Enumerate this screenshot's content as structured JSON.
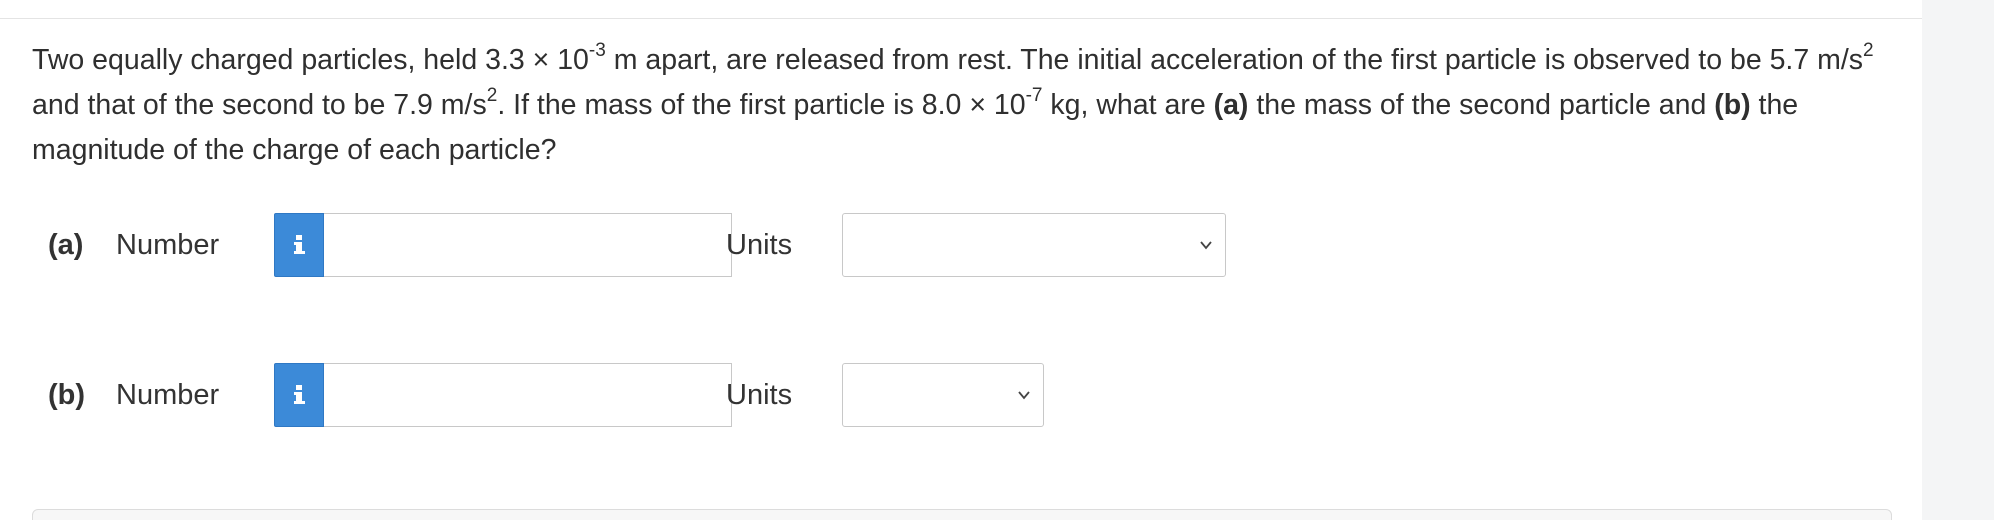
{
  "question": {
    "t1": "Two equally charged particles, held 3.3 × 10",
    "sup1": "-3",
    "t2": " m apart, are released from rest. The initial acceleration of the first particle is observed to be 5.7 m/s",
    "sup2": "2",
    "t3": " and that of the second to be 7.9 m/s",
    "sup3": "2",
    "t4": ". If the mass of the first particle is 8.0 × 10",
    "sup4": "-7",
    "t5": " kg, what are ",
    "bold_a": "(a)",
    "t6": " the mass of the second particle and ",
    "bold_b": "(b)",
    "t7": " the magnitude of the charge of each particle?"
  },
  "parts": [
    {
      "label": "(a)",
      "number_label": "Number",
      "number_value": "",
      "units_label": "Units",
      "units_selected": ""
    },
    {
      "label": "(b)",
      "number_label": "Number",
      "number_value": "",
      "units_label": "Units",
      "units_selected": ""
    }
  ],
  "icons": {
    "info_button": "info-icon",
    "dropdown": "chevron-down-icon"
  },
  "colors": {
    "info_button_bg": "#3c8ad8",
    "text": "#333333",
    "border": "#c8c8c8"
  }
}
